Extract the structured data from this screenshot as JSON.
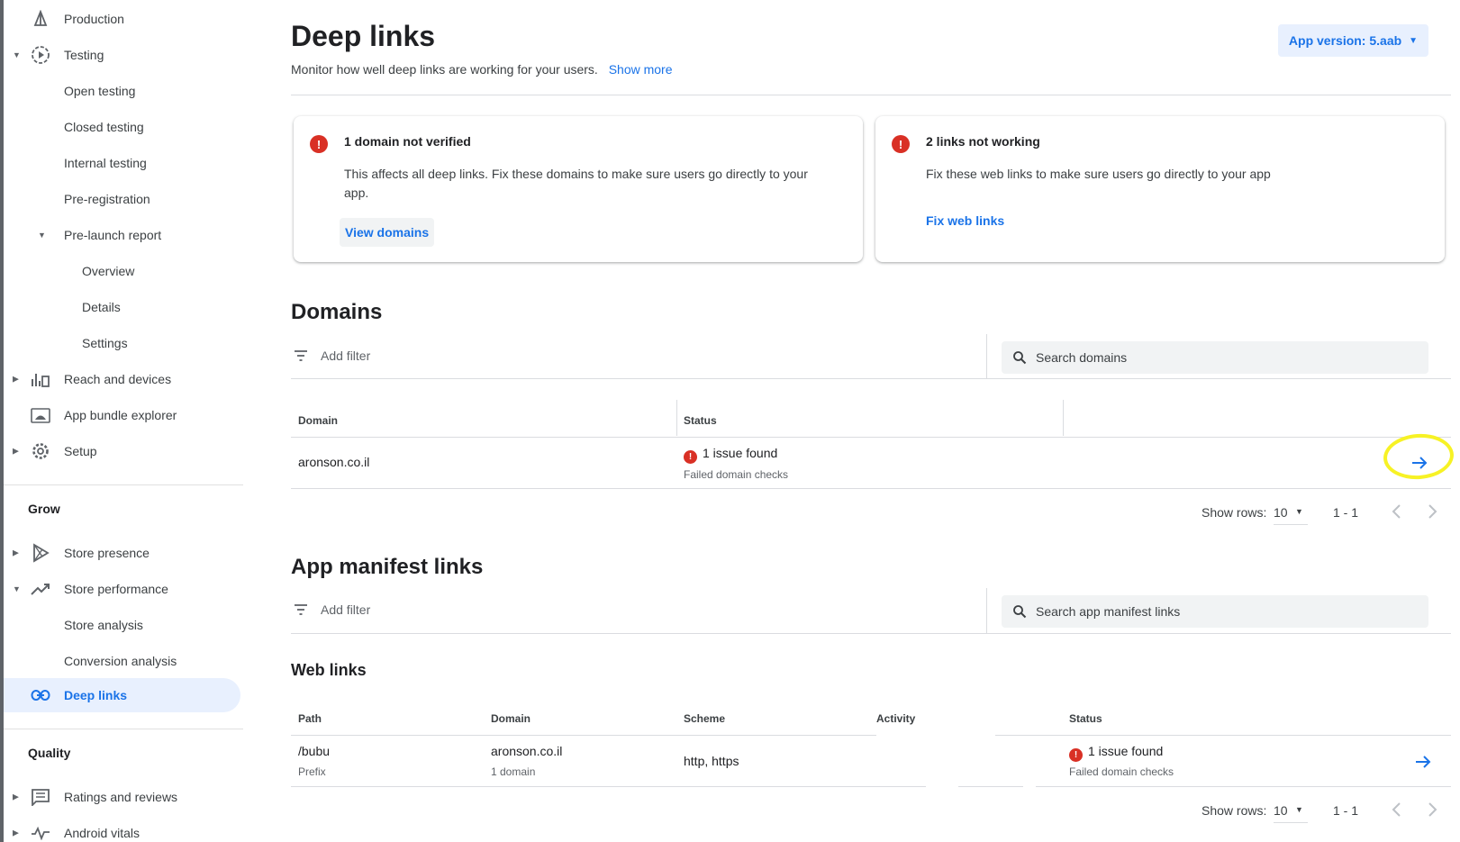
{
  "sidebar": {
    "items": [
      {
        "label": "Production",
        "icon": "production-icon"
      },
      {
        "label": "Testing",
        "icon": "testing-icon"
      },
      {
        "label": "Open testing"
      },
      {
        "label": "Closed testing"
      },
      {
        "label": "Internal testing"
      },
      {
        "label": "Pre-registration"
      },
      {
        "label": "Pre-launch report"
      },
      {
        "label": "Overview"
      },
      {
        "label": "Details"
      },
      {
        "label": "Settings"
      },
      {
        "label": "Reach and devices",
        "icon": "bar-chart-icon"
      },
      {
        "label": "App bundle explorer",
        "icon": "android-icon"
      },
      {
        "label": "Setup",
        "icon": "gear-icon"
      }
    ],
    "grow_title": "Grow",
    "grow_items": [
      {
        "label": "Store presence",
        "icon": "play-icon"
      },
      {
        "label": "Store performance",
        "icon": "trending-icon"
      },
      {
        "label": "Store analysis"
      },
      {
        "label": "Conversion analysis"
      },
      {
        "label": "Deep links",
        "icon": "link-icon"
      }
    ],
    "quality_title": "Quality",
    "quality_items": [
      {
        "label": "Ratings and reviews",
        "icon": "reviews-icon"
      },
      {
        "label": "Android vitals",
        "icon": "vitals-icon"
      }
    ]
  },
  "header": {
    "title": "Deep links",
    "subtitle": "Monitor how well deep links are working for your users.",
    "show_more": "Show more",
    "version_button": "App version: 5.aab"
  },
  "cards": [
    {
      "title": "1 domain not verified",
      "body": "This affects all deep links. Fix these domains to make sure users go directly to your app.",
      "action": "View domains"
    },
    {
      "title": "2 links not working",
      "body": "Fix these web links to make sure users go directly to your app",
      "action": "Fix web links"
    }
  ],
  "domains": {
    "title": "Domains",
    "filter_label": "Add filter",
    "search_placeholder": "Search domains",
    "columns": [
      "Domain",
      "Status"
    ],
    "rows": [
      {
        "domain": "aronson.co.il",
        "status": "1 issue found",
        "status_detail": "Failed domain checks"
      }
    ],
    "pager": {
      "rows_label": "Show rows:",
      "rows_value": "10",
      "range": "1 - 1"
    }
  },
  "manifest": {
    "title": "App manifest links",
    "filter_label": "Add filter",
    "search_placeholder": "Search app manifest links"
  },
  "web_links": {
    "title": "Web links",
    "columns": [
      "Path",
      "Domain",
      "Scheme",
      "Activity",
      "Status"
    ],
    "rows": [
      {
        "path": "/bubu",
        "path_type": "Prefix",
        "domain": "aronson.co.il",
        "domain_count": "1 domain",
        "scheme": "http, https",
        "activity": "",
        "status": "1 issue found",
        "status_detail": "Failed domain checks"
      }
    ],
    "pager": {
      "rows_label": "Show rows:",
      "rows_value": "10",
      "range": "1 - 1"
    }
  },
  "colors": {
    "accent": "#1a73e8",
    "error": "#d93025",
    "highlight_annotation": "#f7f225",
    "active_nav_bg": "#e8f0fe"
  }
}
